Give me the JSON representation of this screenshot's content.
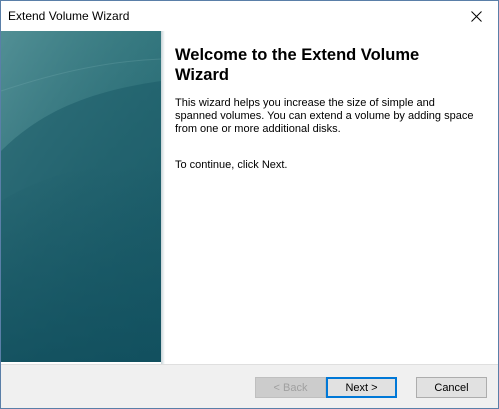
{
  "window": {
    "title": "Extend Volume Wizard"
  },
  "page": {
    "heading": "Welcome to the Extend Volume Wizard",
    "description": "This wizard helps you increase the size of simple and spanned volumes. You can extend a volume  by adding space from one or more additional disks.",
    "continue_text": "To continue, click Next."
  },
  "buttons": {
    "back_label": "< Back",
    "next_label": "Next >",
    "cancel_label": "Cancel"
  },
  "icons": {
    "close": "close-icon"
  },
  "colors": {
    "banner": "#1e5f6b",
    "accent": "#0078d7"
  }
}
